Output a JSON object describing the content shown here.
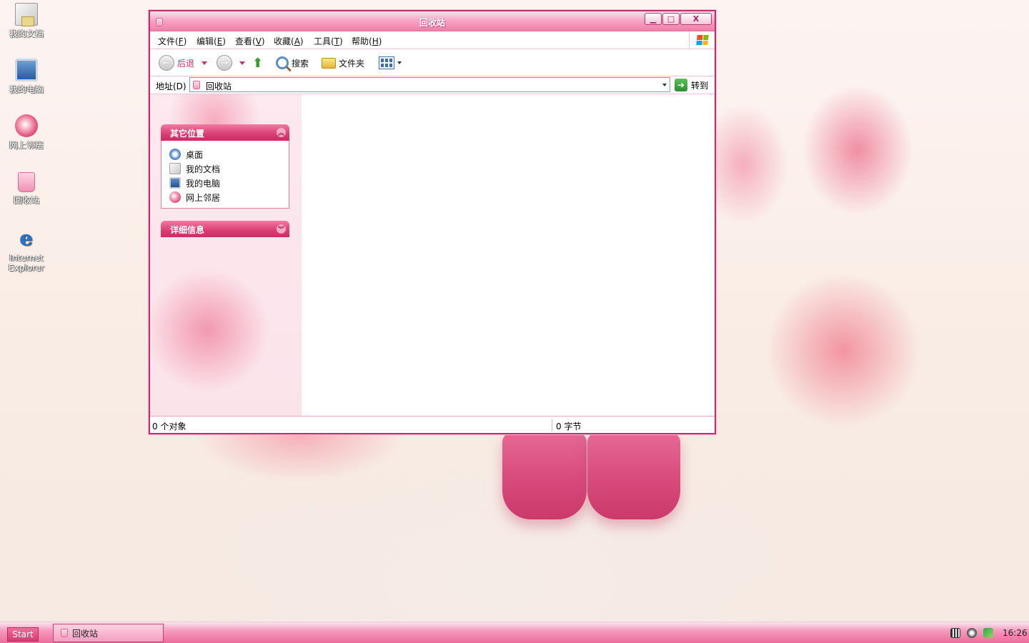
{
  "desktop": {
    "icons": [
      {
        "label": "我的文档",
        "icon": "my-documents-icon"
      },
      {
        "label": "我的电脑",
        "icon": "my-computer-icon"
      },
      {
        "label": "网上邻居",
        "icon": "network-places-icon"
      },
      {
        "label": "回收站",
        "icon": "recycle-bin-icon"
      },
      {
        "label_line1": "Internet",
        "label_line2": "Explorer",
        "icon_glyph": "e",
        "icon": "internet-explorer-icon"
      }
    ]
  },
  "window": {
    "title": "回收站",
    "controls": {
      "minimize": "▁",
      "maximize": "□",
      "close": "X"
    },
    "menu": [
      {
        "label": "文件(",
        "key": "F",
        "suffix": ")"
      },
      {
        "label": "编辑(",
        "key": "E",
        "suffix": ")"
      },
      {
        "label": "查看(",
        "key": "V",
        "suffix": ")"
      },
      {
        "label": "收藏(",
        "key": "A",
        "suffix": ")"
      },
      {
        "label": "工具(",
        "key": "T",
        "suffix": ")"
      },
      {
        "label": "帮助(",
        "key": "H",
        "suffix": ")"
      }
    ],
    "toolbar": {
      "back_label": "后退",
      "back_glyph": "←",
      "forward_glyph": "→",
      "up_glyph": "⬆",
      "search_label": "搜索",
      "folders_label": "文件夹"
    },
    "address": {
      "label": "地址(D)",
      "value": "回收站",
      "go_label": "转到",
      "go_glyph": "➔"
    },
    "taskpane": {
      "other_places": {
        "title": "其它位置",
        "chevron": "︽",
        "items": [
          {
            "label": "桌面",
            "icon": "desktop-icon"
          },
          {
            "label": "我的文档",
            "icon": "my-documents-icon"
          },
          {
            "label": "我的电脑",
            "icon": "my-computer-icon"
          },
          {
            "label": "网上邻居",
            "icon": "network-places-icon"
          }
        ]
      },
      "details": {
        "title": "详细信息",
        "chevron": "︾"
      }
    },
    "status": {
      "objects": "0 个对象",
      "size": "0 字节"
    }
  },
  "taskbar": {
    "start_label": "Start",
    "task_label": "回收站",
    "clock": "16:26"
  },
  "colors": {
    "accent": "#d93d73",
    "frame": "#c0306e",
    "title_text": "#ffffff"
  }
}
